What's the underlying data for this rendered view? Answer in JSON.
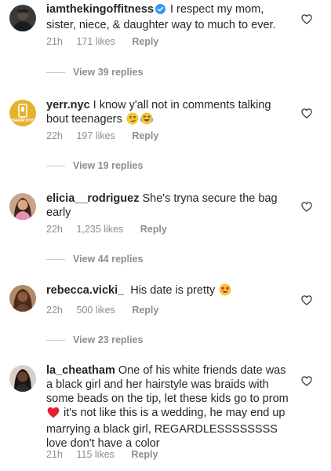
{
  "comments": [
    {
      "username": "iamthekingoffitness",
      "verified": true,
      "text": "I respect my mom, sister, niece, & daughter way to much to ever.",
      "time": "21h",
      "likes": "171 likes",
      "reply": "Reply",
      "view_replies": "View 39 replies",
      "avatar": "avatar-man-dark"
    },
    {
      "username": "yerr.nyc",
      "verified": false,
      "text": "I know y'all not in comments talking bout teenagers",
      "emojis": [
        "smirk-emoji",
        "laughing-emoji"
      ],
      "time": "22h",
      "likes": "197 likes",
      "reply": "Reply",
      "view_replies": "View 19 replies",
      "avatar": "yerr-nyc-logo",
      "avatar_label": "YERRR NYC"
    },
    {
      "username": "elicia__rodriguez",
      "verified": false,
      "text": "She's tryna secure the bag early",
      "time": "22h",
      "likes": "1,235 likes",
      "reply": "Reply",
      "view_replies": "View 44 replies",
      "avatar": "avatar-woman-pink"
    },
    {
      "username": "rebecca.vicki_",
      "verified": false,
      "text": "His date is pretty",
      "emojis": [
        "heart-eyes-emoji"
      ],
      "time": "22h",
      "likes": "500 likes",
      "reply": "Reply",
      "view_replies": "View 23 replies",
      "avatar": "avatar-woman-brown"
    },
    {
      "username": "la_cheatham",
      "verified": false,
      "text_a": "One of his white friends date was a black girl and her hairstyle was braids with some beads on the tip, let these kids go to prom",
      "text_b": "it's not like this is a wedding, he may end up marrying a black girl, REGARDLESSSSSSSS love don't have a color",
      "emojis": [
        "red-heart-emoji"
      ],
      "time": "21h",
      "likes": "115 likes",
      "reply": "Reply",
      "avatar": "avatar-woman-dark"
    }
  ],
  "colors": {
    "text": "#262626",
    "meta": "#8e8e8e",
    "verified": "#3897f0",
    "divider": "#c7c7c7"
  }
}
